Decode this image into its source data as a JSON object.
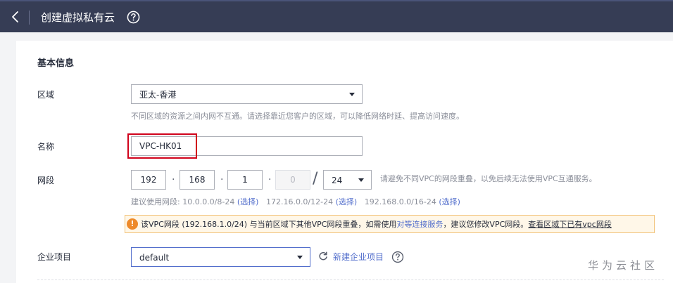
{
  "header": {
    "title": "创建虚拟私有云"
  },
  "section": {
    "title": "基本信息"
  },
  "region": {
    "label": "区域",
    "value": "亚太-香港",
    "hint": "不同区域的资源之间内网不互通。请选择靠近您客户的区域，可以降低网络时延、提高访问速度。"
  },
  "name": {
    "label": "名称",
    "value": "VPC-HK01"
  },
  "cidr": {
    "label": "网段",
    "octet1": "192",
    "octet2": "168",
    "octet3": "1",
    "octet4": "0",
    "dot": "·",
    "slash": "/",
    "mask": "24",
    "hint": "请避免不同VPC的网段重叠，以免后续无法使用VPC互通服务。",
    "suggest_prefix": "建议使用网段: ",
    "suggest_1": "10.0.0.0/8-24",
    "suggest_2": "172.16.0.0/12-24",
    "suggest_3": "192.168.0.0/16-24",
    "select_link": "(选择)"
  },
  "warning": {
    "text_before": "该VPC网段 (192.168.1.0/24) 与当前区域下其他VPC网段重叠，如需使用",
    "link": "对等连接服务",
    "text_mid": "，建议您修改VPC网段。",
    "underline": "查看区域下已有vpc网段",
    "icon": "!"
  },
  "enterprise": {
    "label": "企业项目",
    "value": "default",
    "new_link": "新建企业项目"
  },
  "watermark": "华为云社区",
  "colors": {
    "header_bg": "#363d55",
    "link": "#526ecc",
    "highlight": "#d0021b",
    "warning_bg": "#fff7e8",
    "warning_border": "#f2c37a"
  }
}
